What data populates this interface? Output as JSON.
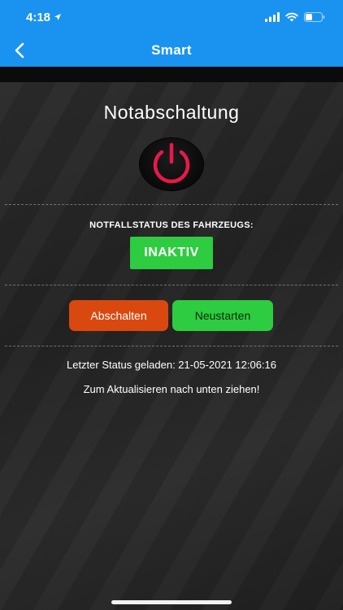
{
  "status_bar": {
    "time": "4:18",
    "icons": [
      "location-arrow-icon",
      "cellular-signal-icon",
      "wifi-icon",
      "battery-icon"
    ]
  },
  "nav": {
    "title": "Smart",
    "back_icon": "chevron-left-icon"
  },
  "main": {
    "title": "Notabschaltung",
    "power_icon": "power-icon",
    "status_label": "NOTFALLSTATUS DES FAHRZEUGS:",
    "status_value": "INAKTIV",
    "buttons": {
      "stop_label": "Abschalten",
      "restart_label": "Neustarten"
    },
    "last_status": "Letzter Status geladen: 21-05-2021 12:06:16",
    "refresh_hint": "Zum Aktualisieren nach unten ziehen!"
  },
  "colors": {
    "header": "#1a93f0",
    "power_ring": "#e8194a",
    "status_green": "#2ecc40",
    "stop_orange": "#d9480f"
  }
}
